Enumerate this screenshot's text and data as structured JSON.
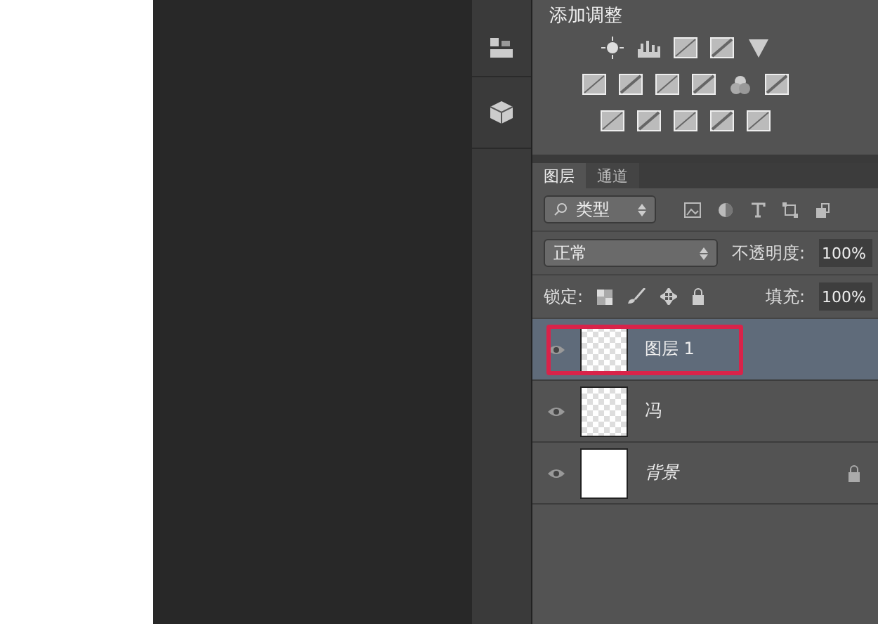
{
  "adjustments": {
    "title": "添加调整"
  },
  "tabs": [
    {
      "label": "图层",
      "selected": true
    },
    {
      "label": "通道",
      "selected": false
    }
  ],
  "filter": {
    "value": "类型"
  },
  "blend_mode": {
    "value": "正常"
  },
  "opacity": {
    "label": "不透明度:",
    "value": "100%"
  },
  "lock": {
    "label": "锁定:"
  },
  "fill": {
    "label": "填充:",
    "value": "100%"
  },
  "layers": [
    {
      "name": "图层 1",
      "kind": "layer",
      "selected": true,
      "visible": true,
      "locked": false,
      "highlighted": true
    },
    {
      "name": "冯",
      "kind": "layer",
      "selected": false,
      "visible": true,
      "locked": false,
      "highlighted": false
    },
    {
      "name": "背景",
      "kind": "background",
      "selected": false,
      "visible": true,
      "locked": true,
      "highlighted": false
    }
  ]
}
